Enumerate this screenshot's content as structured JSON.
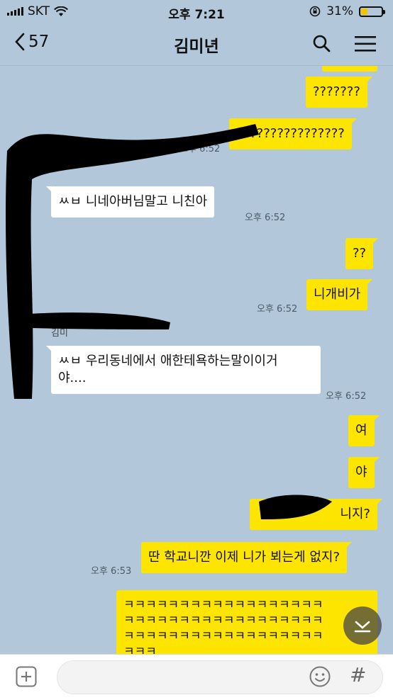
{
  "status_bar": {
    "carrier": "SKT",
    "time": "오후 7:21",
    "battery": "31%",
    "battery_level": 0.31
  },
  "header": {
    "back_count": "57",
    "title": "김미년"
  },
  "messages": {
    "m1": "???????",
    "m2": "????????????????",
    "m2_time": "오후 6:52",
    "m3": "ㅆㅂ 니네아버님말고 니친아",
    "m3_time": "오후 6:52",
    "m4": "??",
    "m5": "니개비가",
    "m5_time": "오후 6:52",
    "sender_partial": "김미",
    "m6": "ㅆㅂ 우리동네에서 애한테욕하는말이이거\n야....",
    "m6_time": "오후 6:52",
    "m7": "여",
    "m8": "야",
    "m9": "니지?",
    "m10": "딴 학교니깐 이제 니가 뵈는게 없지?",
    "m10_time": "오후 6:53",
    "m11": "ㅋㅋㅋㅋㅋㅋㅋㅋㅋㅋㅋㅋㅋㅋㅋㅋㅋㅋ\nㅋㅋㅋㅋㅋㅋㅋㅋㅋㅋㅋㅋㅋㅋㅋㅋㅋㅋ\nㅋㅋㅋㅋㅋㅋㅋㅋㅋㅋㅋㅋㅋㅋㅋㅋㅋㅋ\nㅋㅋㅋ"
  },
  "colors": {
    "background": "#b2c7d9",
    "my_bubble": "#fee500",
    "their_bubble": "#ffffff"
  },
  "icons": [
    "chevron-left-icon",
    "search-icon",
    "menu-icon",
    "plus-icon",
    "emoji-icon",
    "hash-icon",
    "chevron-down-icon"
  ]
}
